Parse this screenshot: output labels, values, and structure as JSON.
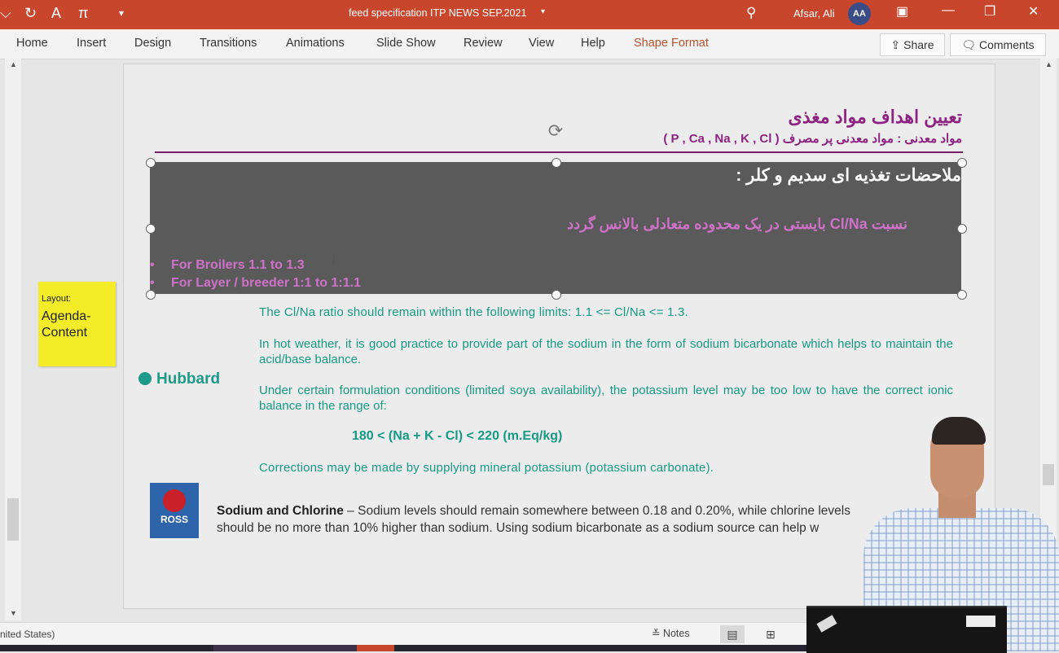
{
  "titlebar": {
    "doc_title": "feed specification ITP NEWS SEP.2021",
    "user_name": "Afsar, Ali",
    "user_initials": "AA",
    "bg_color": "#c8462b"
  },
  "ribbon": {
    "tabs": [
      "Home",
      "Insert",
      "Design",
      "Transitions",
      "Animations",
      "Slide Show",
      "Review",
      "View",
      "Help",
      "Shape Format"
    ],
    "share_label": "Share",
    "comments_label": "Comments"
  },
  "sticky_note": {
    "line1": "Layout:",
    "line2": "Agenda-",
    "line3": "Content"
  },
  "slide": {
    "heading": "تعیین اهداف مواد مغذی",
    "subheading": "مواد معدنی : مواد معدنی پر مصرف ( P , Ca , Na , K , Cl )",
    "box_heading": "ملاحضات تغذیه ای سدیم و کلر :",
    "box_ratio": "نسبت  Cl/Na بایستی در یک محدوده متعادلی بالانس گردد",
    "bullets": [
      "For Broilers 1.1 to 1.3",
      "For Layer / breeder 1:1 to 1:1.1"
    ],
    "hubbard_logo": "Hubbard",
    "hubbard_text": {
      "p1": "The Cl/Na ratio should remain within the following limits: 1.1 <= Cl/Na <= 1.3.",
      "p2": "In hot weather, it is good practice to provide part of the sodium in the form of sodium  bicarbonate which helps to maintain the acid/base balance.",
      "p3": "Under certain formulation conditions (limited soya availability), the potassium level may be too low to have the correct ionic balance in the range of:",
      "formula": "180 < (Na + K - Cl) < 220 (m.Eq/kg)",
      "p4": "Corrections may be made by supplying mineral potassium (potassium carbonate)."
    },
    "ross_logo": "ROSS",
    "ross_text": {
      "bold": "Sodium and Chlorine",
      "line1": " – Sodium levels should remain somewhere between 0.18 and 0.20%, while chlorine levels",
      "line2": "should be no more than 10% higher than sodium. Using sodium bicarbonate as a sodium source can help w"
    }
  },
  "statusbar": {
    "language": "nited States)",
    "notes_label": "Notes"
  },
  "icons": [
    "save-icon",
    "undo-icon",
    "font-color-icon",
    "pi-icon",
    "search-icon",
    "share-icon",
    "comments-icon"
  ],
  "colors": {
    "accent": "#8e2283",
    "teal": "#169a83",
    "box": "#5a5a5a",
    "pink": "#ce72c7"
  }
}
